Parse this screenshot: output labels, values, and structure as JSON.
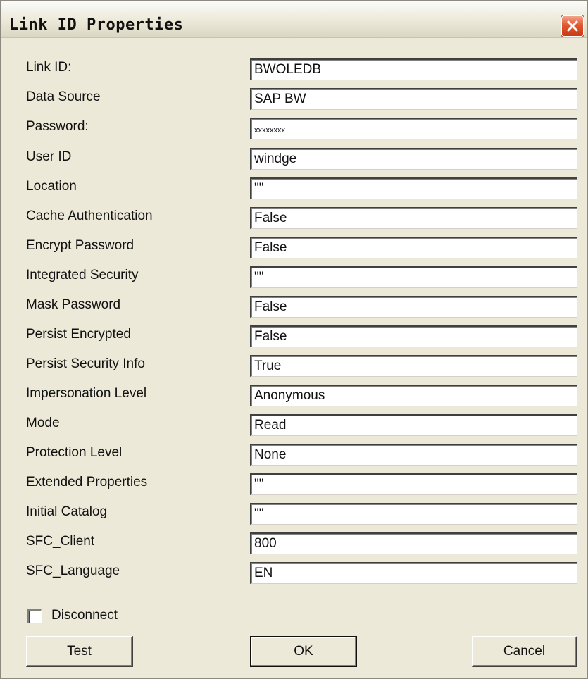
{
  "window": {
    "title": "Link ID Properties"
  },
  "properties": [
    {
      "label": "Link ID:",
      "value": "BWOLEDB"
    },
    {
      "label": "Data Source",
      "value": "SAP BW"
    },
    {
      "label": "Password:",
      "value": "xxxxxxxx"
    },
    {
      "label": "User ID",
      "value": "windge"
    },
    {
      "label": "Location",
      "value": "\"\""
    },
    {
      "label": "Cache Authentication",
      "value": "False"
    },
    {
      "label": "Encrypt Password",
      "value": "False"
    },
    {
      "label": "Integrated Security",
      "value": "\"\""
    },
    {
      "label": "Mask Password",
      "value": "False"
    },
    {
      "label": "Persist Encrypted",
      "value": "False"
    },
    {
      "label": "Persist Security Info",
      "value": "True"
    },
    {
      "label": "Impersonation Level",
      "value": "Anonymous"
    },
    {
      "label": "Mode",
      "value": "Read"
    },
    {
      "label": "Protection Level",
      "value": "None"
    },
    {
      "label": "Extended Properties",
      "value": "\"\""
    },
    {
      "label": "Initial Catalog",
      "value": "\"\""
    },
    {
      "label": "SFC_Client",
      "value": "800"
    },
    {
      "label": "SFC_Language",
      "value": "EN"
    }
  ],
  "disconnect": {
    "label": "Disconnect",
    "checked": false
  },
  "buttons": {
    "test": "Test",
    "ok": "OK",
    "cancel": "Cancel"
  }
}
